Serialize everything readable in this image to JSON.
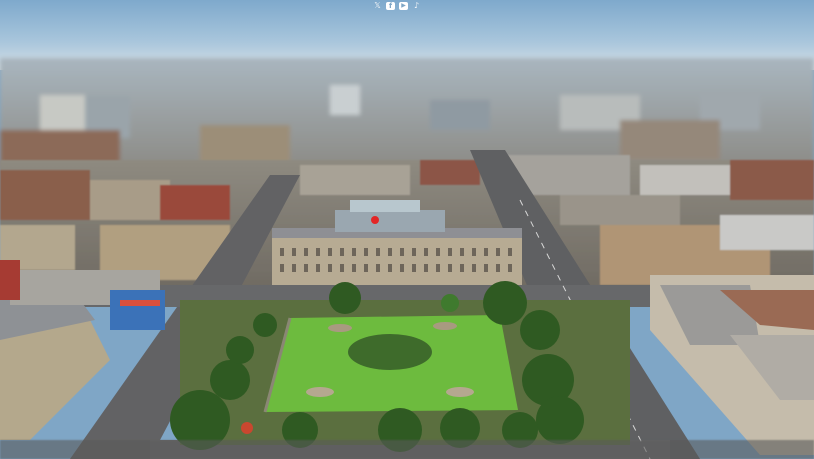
{
  "scene": {
    "subject": "aerial-city-square",
    "sky_color": "#8fb6d6",
    "haze_color": "#d3dfe7",
    "grass_color": "#6dbb3e",
    "road_color": "#6b6b6b",
    "building_stone": "#b9a98d",
    "building_brick": "#8d5a45",
    "accent_red": "#e32626"
  },
  "social_icons": [
    "x-icon",
    "facebook-icon",
    "youtube-icon",
    "tiktok-icon"
  ]
}
